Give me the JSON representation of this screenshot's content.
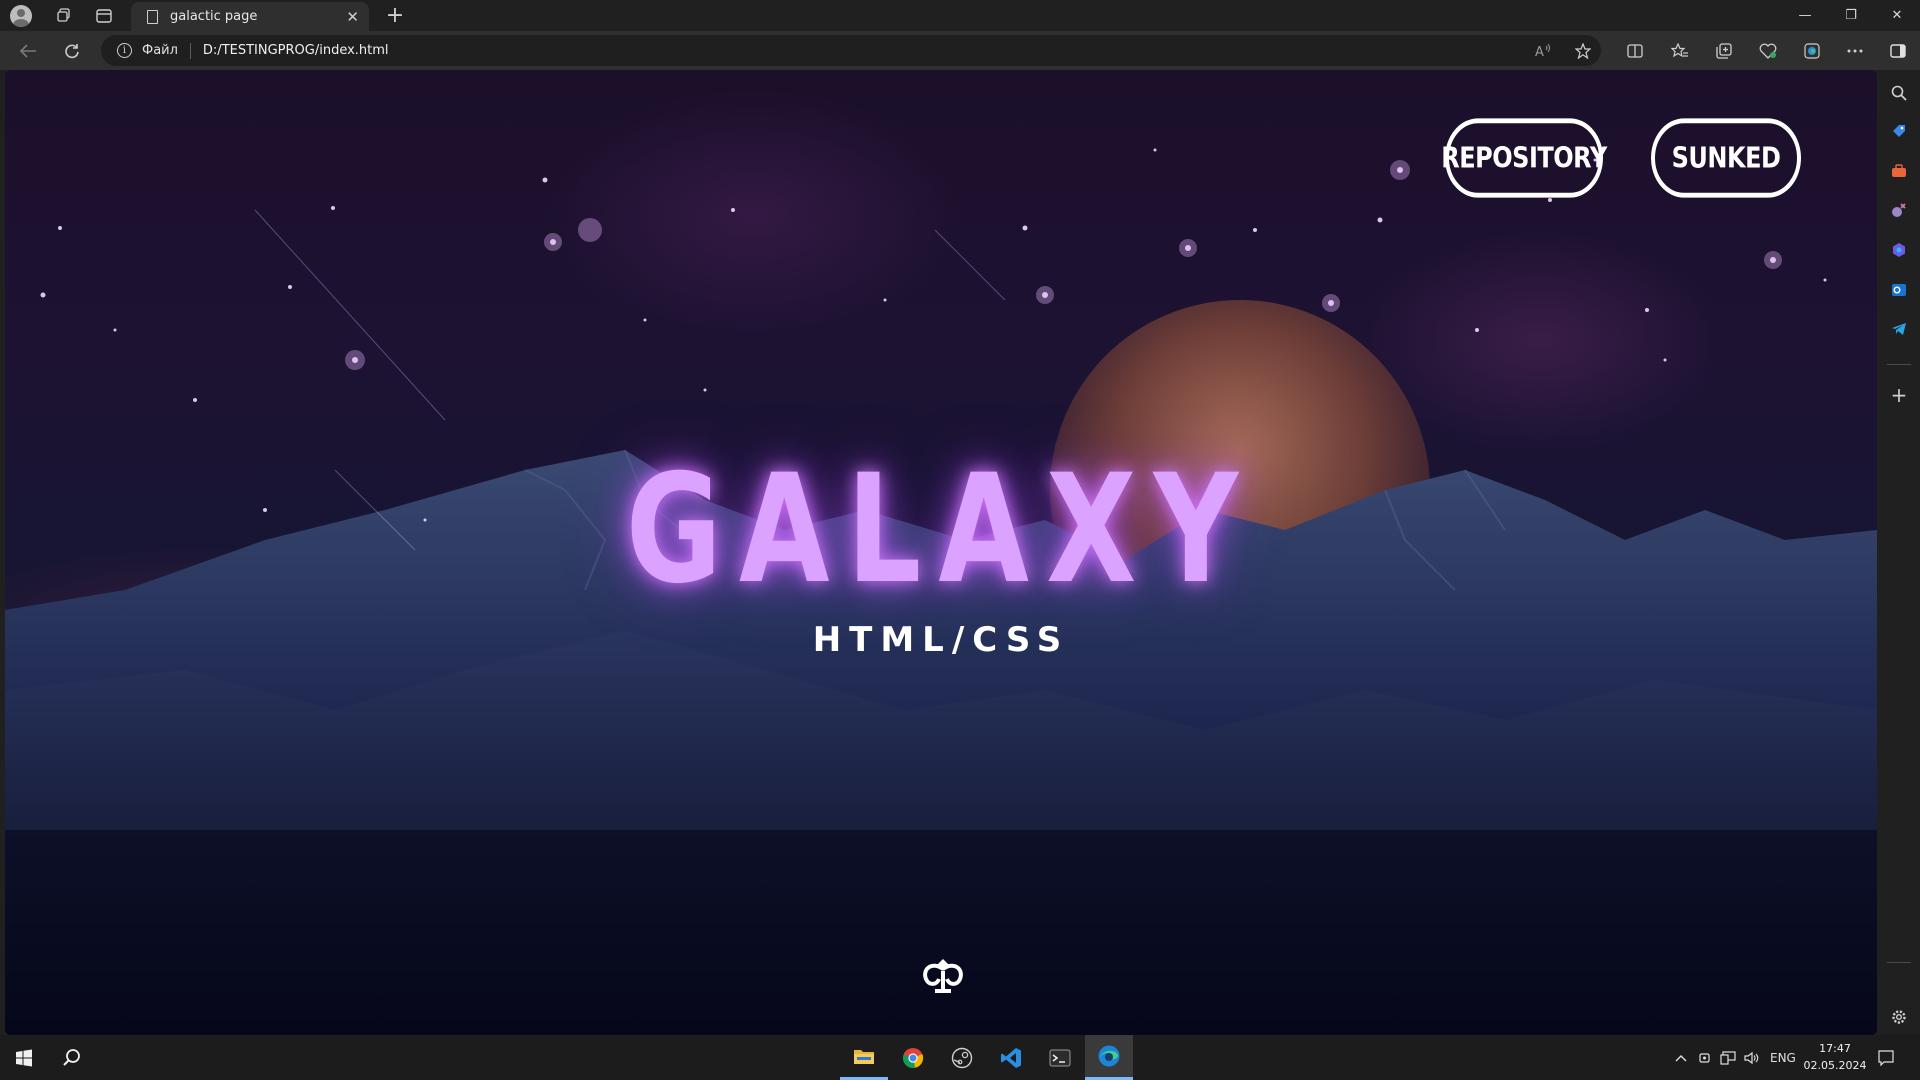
{
  "browser": {
    "tab": {
      "title": "galactic page",
      "close_glyph": "✕"
    },
    "new_tab_glyph": "+",
    "window_controls": {
      "minimize": "—",
      "restore": "❐",
      "close": "✕"
    },
    "address": {
      "scheme_label": "Файл",
      "url": "D:/TESTINGPROG/index.html"
    },
    "toolbar_icons": [
      "read-aloud-icon",
      "favorite-star-icon",
      "split-screen-icon",
      "favorites-icon",
      "collections-icon",
      "performance-icon",
      "copilot-icon",
      "more-icon"
    ],
    "sidebar_icons": [
      "search-icon",
      "shopping-tag-icon",
      "tools-icon",
      "games-icon",
      "copilot-icon",
      "outlook-icon",
      "telegram-icon",
      "add-icon",
      "settings-icon"
    ]
  },
  "page": {
    "nav": {
      "repository_label": "REPOSITORY",
      "sunked_label": "SUNKED"
    },
    "hero": {
      "title": "GALAXY",
      "subtitle": "HTML/CSS"
    },
    "colors": {
      "title": "#dba2ff",
      "glow": "#b95cff",
      "pill_border": "#ffffff"
    }
  },
  "taskbar": {
    "apps": [
      "windows-start-icon",
      "search-icon",
      "file-explorer-icon",
      "chrome-icon",
      "steam-icon",
      "vscode-icon",
      "terminal-icon",
      "edge-icon"
    ],
    "tray": {
      "language": "ENG",
      "time": "17:47",
      "date": "02.05.2024"
    }
  }
}
